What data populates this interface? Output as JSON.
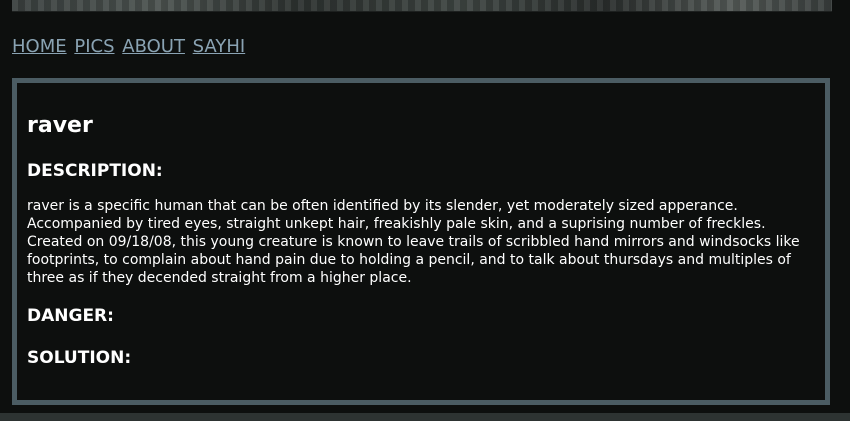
{
  "nav": {
    "items": [
      {
        "label": "HOME"
      },
      {
        "label": "PICS"
      },
      {
        "label": "ABOUT"
      },
      {
        "label": "SAYHI"
      }
    ]
  },
  "entry": {
    "title": "raver",
    "description_heading": "DESCRIPTION:",
    "description_text": "raver is a specific human that can be often identified by its slender, yet moderately sized apperance. Accompanied by tired eyes, straight unkept hair, freakishly pale skin, and a suprising number of freckles. Created on 09/18/08, this young creature is known to leave trails of scribbled hand mirrors and windsocks like footprints, to complain about hand pain due to holding a pencil, and to talk about thursdays and multiples of three as if they decended straight from a higher place.",
    "danger_heading": "DANGER:",
    "solution_heading": "SOLUTION:"
  },
  "colors": {
    "background": "#0d0f0e",
    "panel_border": "#4b5c63",
    "link": "#8aa3b3",
    "text": "#ffffff"
  }
}
